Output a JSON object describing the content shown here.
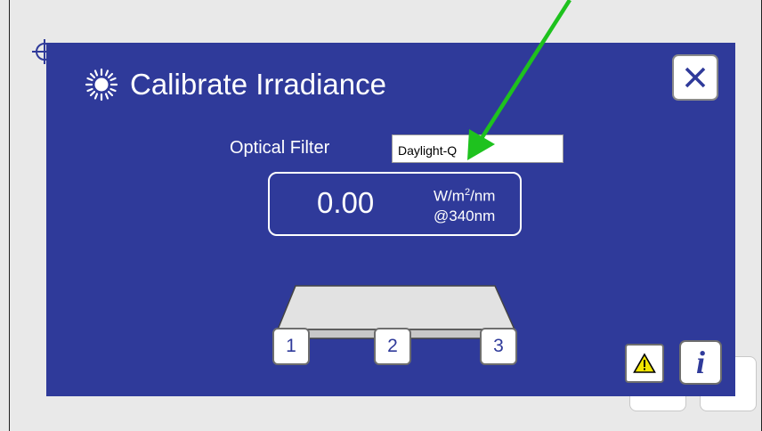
{
  "dialog": {
    "title": "Calibrate Irradiance",
    "title_icon": "sun-icon",
    "close_icon": "close-icon"
  },
  "optical_filter": {
    "label": "Optical Filter",
    "value": "Daylight-Q"
  },
  "readout": {
    "value": "0.00",
    "unit_line1_prefix": "W/m",
    "unit_line1_sup": "2",
    "unit_line1_suffix": "/nm",
    "unit_line2": "@340nm"
  },
  "positions": [
    "1",
    "2",
    "3"
  ],
  "footer": {
    "warning_icon": "warning-icon",
    "info_label": "i"
  },
  "colors": {
    "dialog_bg": "#2f3a9a",
    "annotation_arrow": "#1ec21e",
    "warning_yellow": "#f2e500"
  }
}
